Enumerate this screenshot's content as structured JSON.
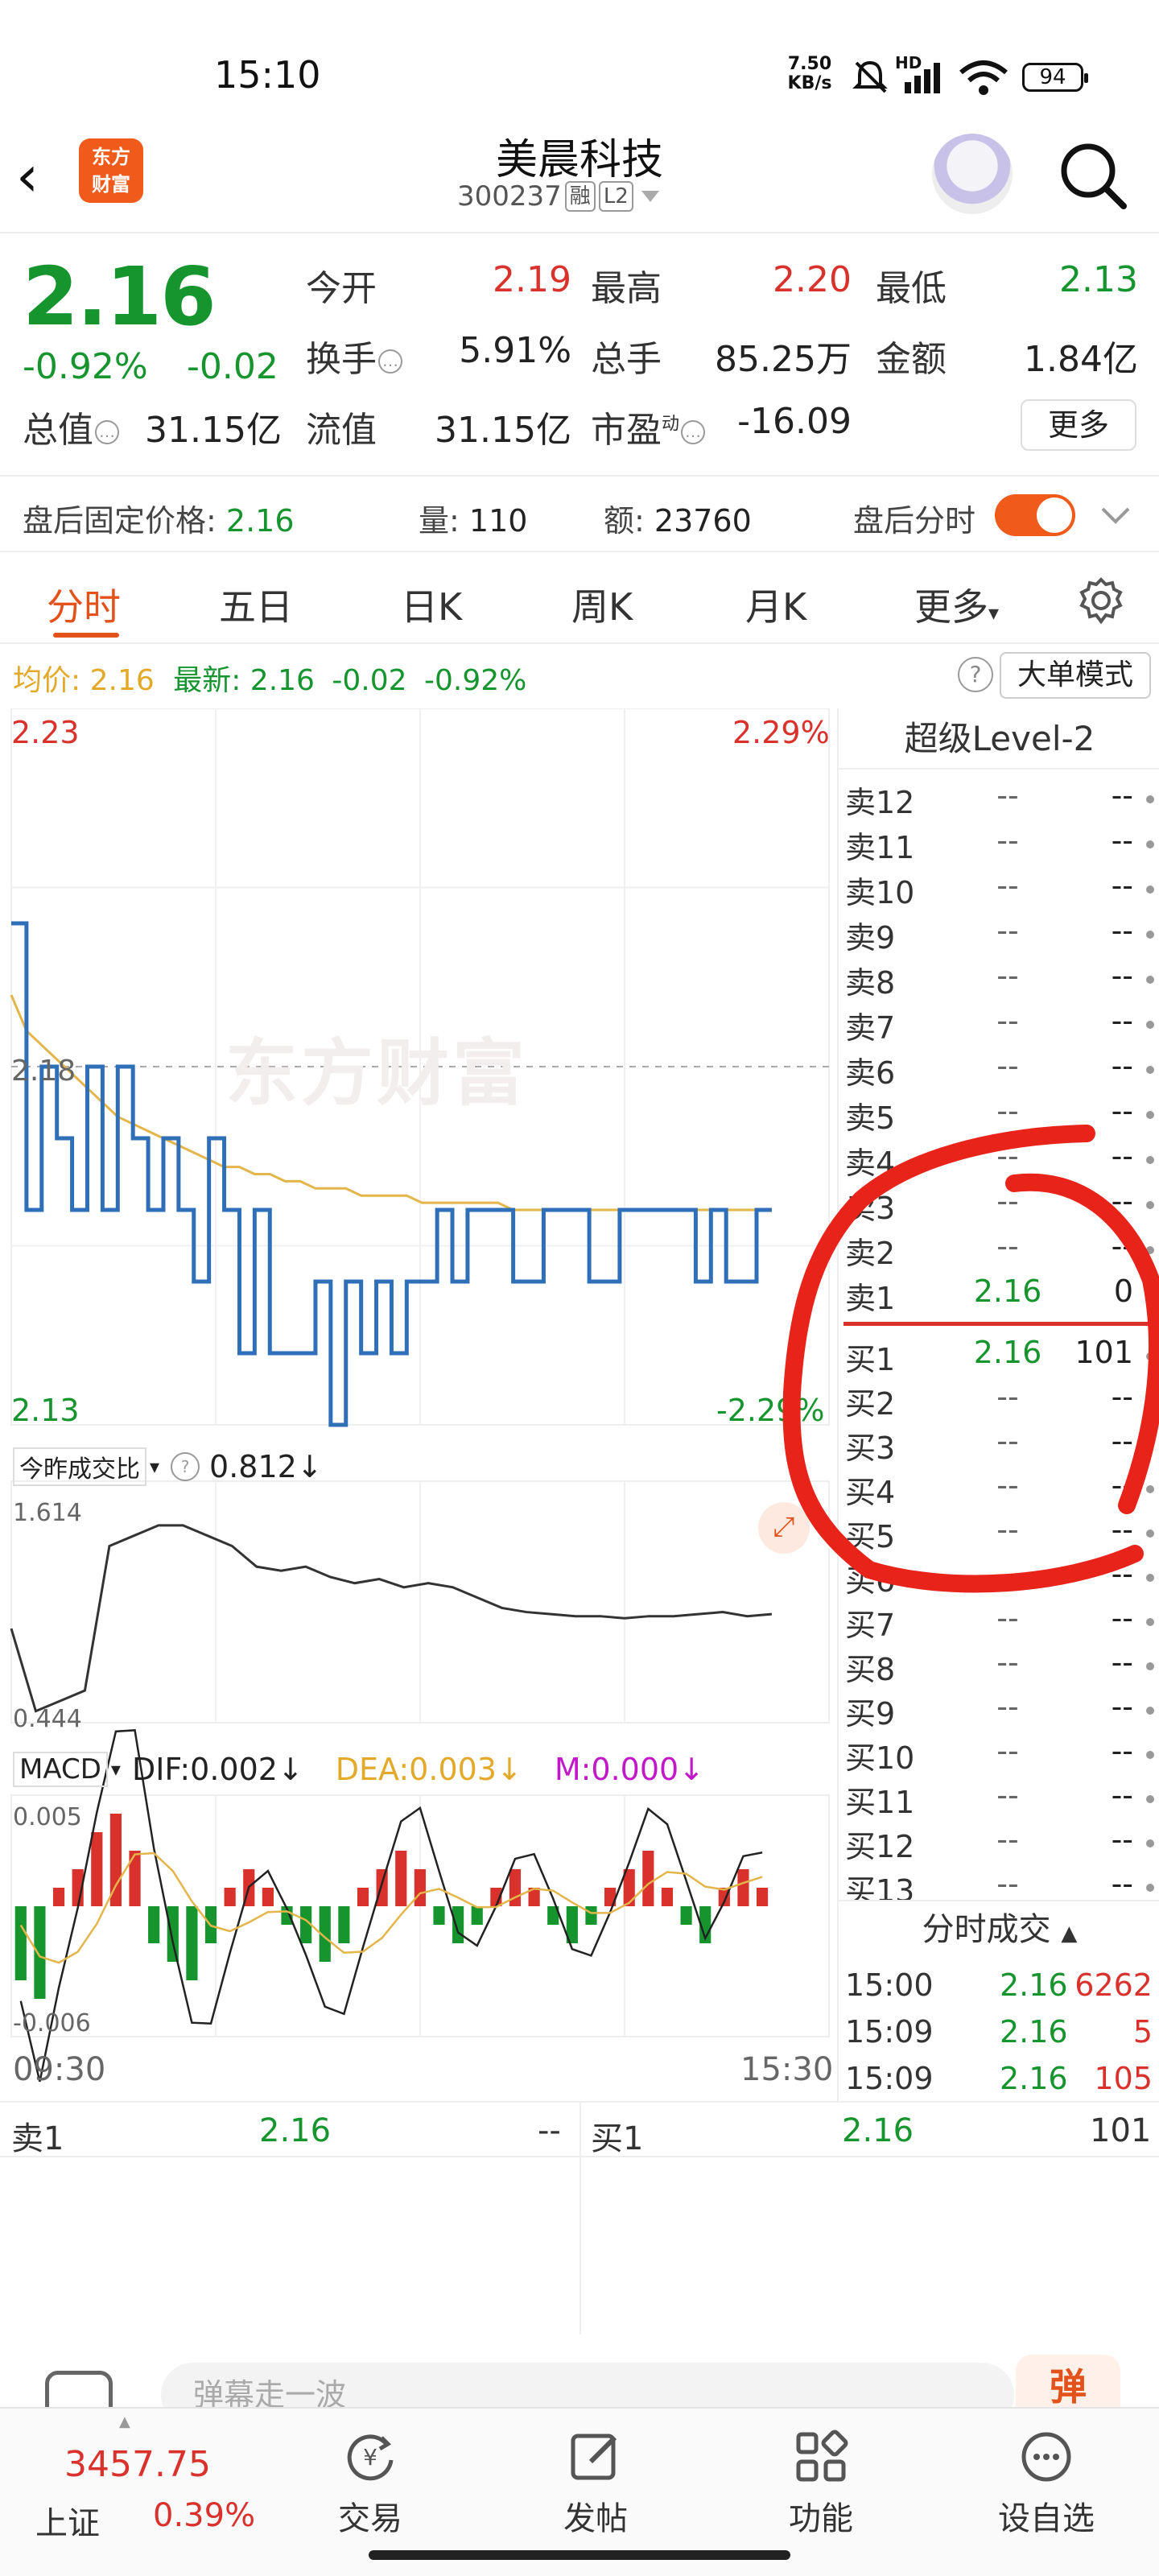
{
  "status_bar": {
    "time": "15:10",
    "net_speed": "7.50",
    "net_unit": "KB/s",
    "signal_tag": "HD",
    "battery": "94"
  },
  "header": {
    "stock_name": "美晨科技",
    "stock_code": "300237",
    "tag_margin": "融",
    "tag_level": "L2",
    "logo_line1": "东方",
    "logo_line2": "财富"
  },
  "quote": {
    "last_price": "2.16",
    "pct_change": "-0.92%",
    "abs_change": "-0.02",
    "open_label": "今开",
    "open": "2.19",
    "high_label": "最高",
    "high": "2.20",
    "low_label": "最低",
    "low": "2.13",
    "turnover_label": "换手",
    "turnover": "5.91%",
    "volume_label": "总手",
    "volume": "85.25万",
    "amount_label": "金额",
    "amount": "1.84亿",
    "mktcap_label": "总值",
    "mktcap": "31.15亿",
    "float_label": "流值",
    "float_cap": "31.15亿",
    "pe_label": "市盈",
    "pe_sup": "动",
    "pe": "-16.09",
    "more_label": "更多"
  },
  "afterhours": {
    "price_label": "盘后固定价格:",
    "price": "2.16",
    "vol_label": "量:",
    "vol": "110",
    "amt_label": "额:",
    "amt": "23760",
    "toggle_label": "盘后分时"
  },
  "tabs": [
    {
      "label": "分时"
    },
    {
      "label": "五日"
    },
    {
      "label": "日K"
    },
    {
      "label": "周K"
    },
    {
      "label": "月K"
    },
    {
      "label": "更多"
    }
  ],
  "chart_info": {
    "avg_label": "均价:",
    "avg": "2.16",
    "latest_label": "最新:",
    "latest": "2.16",
    "latest_chg": "-0.02",
    "latest_pct": "-0.92%",
    "big_order_mode": "大单模式"
  },
  "chart_data": [
    {
      "type": "line",
      "title": "",
      "ylim": [
        2.13,
        2.23
      ],
      "y_ticks": [
        "2.23",
        "2.18",
        "2.13"
      ],
      "y_pct_ticks": [
        "2.29%",
        "-2.29%"
      ],
      "x_ticks": [
        "09:30",
        "15:30"
      ],
      "watermark": "东方财富",
      "series": [
        {
          "values": [
            2.2,
            2.16,
            2.18,
            2.17,
            2.16,
            2.18,
            2.16,
            2.18,
            2.17,
            2.16,
            2.17,
            2.16,
            2.15,
            2.17,
            2.16,
            2.14,
            2.16,
            2.14,
            2.14,
            2.14,
            2.15,
            2.13,
            2.15,
            2.14,
            2.15,
            2.14,
            2.15,
            2.15,
            2.16,
            2.15,
            2.16,
            2.16,
            2.16,
            2.15,
            2.15,
            2.16,
            2.16,
            2.16,
            2.15,
            2.15,
            2.16,
            2.16,
            2.16,
            2.16,
            2.16,
            2.15,
            2.16,
            2.15,
            2.15,
            2.16,
            2.16
          ]
        },
        {
          "values": [
            2.19,
            2.185,
            2.183,
            2.181,
            2.179,
            2.177,
            2.175,
            2.173,
            2.172,
            2.171,
            2.17,
            2.169,
            2.168,
            2.167,
            2.166,
            2.166,
            2.165,
            2.165,
            2.164,
            2.164,
            2.163,
            2.163,
            2.163,
            2.162,
            2.162,
            2.162,
            2.162,
            2.161,
            2.161,
            2.161,
            2.161,
            2.161,
            2.161,
            2.16,
            2.16,
            2.16,
            2.16,
            2.16,
            2.16,
            2.16,
            2.16,
            2.16,
            2.16,
            2.16,
            2.16,
            2.16,
            2.16,
            2.16,
            2.16,
            2.16,
            2.16
          ]
        }
      ]
    },
    {
      "type": "line",
      "title": "今昨成交比",
      "value_label": "0.812",
      "ylim": [
        0.444,
        1.614
      ],
      "y_ticks": [
        "1.614",
        "0.444"
      ],
      "series": [
        {
          "values": [
            0.9,
            0.5,
            0.55,
            0.6,
            1.3,
            1.35,
            1.4,
            1.4,
            1.35,
            1.3,
            1.2,
            1.18,
            1.2,
            1.15,
            1.12,
            1.14,
            1.1,
            1.12,
            1.1,
            1.05,
            1.0,
            0.98,
            0.97,
            0.96,
            0.96,
            0.95,
            0.96,
            0.96,
            0.97,
            0.98,
            0.96,
            0.97
          ]
        }
      ]
    },
    {
      "type": "bar",
      "title": "MACD",
      "dif": "DIF:0.002",
      "dea": "DEA:0.003",
      "m": "M:0.000",
      "y_ticks": [
        "0.005",
        "-0.006"
      ],
      "values": [
        -0.004,
        -0.005,
        0.001,
        0.002,
        0.004,
        0.005,
        0.003,
        -0.002,
        -0.003,
        -0.004,
        -0.002,
        0.001,
        0.002,
        0.001,
        -0.001,
        -0.002,
        -0.003,
        -0.002,
        0.001,
        0.002,
        0.003,
        0.002,
        -0.001,
        -0.002,
        -0.001,
        0.001,
        0.002,
        0.001,
        -0.001,
        -0.002,
        -0.001,
        0.001,
        0.002,
        0.003,
        0.001,
        -0.001,
        -0.002,
        0.001,
        0.002,
        0.001
      ]
    }
  ],
  "order_book": {
    "title": "超级Level-2",
    "asks": [
      {
        "label": "卖12",
        "price": "--",
        "vol": "--"
      },
      {
        "label": "卖11",
        "price": "--",
        "vol": "--"
      },
      {
        "label": "卖10",
        "price": "--",
        "vol": "--"
      },
      {
        "label": "卖9",
        "price": "--",
        "vol": "--"
      },
      {
        "label": "卖8",
        "price": "--",
        "vol": "--"
      },
      {
        "label": "卖7",
        "price": "--",
        "vol": "--"
      },
      {
        "label": "卖6",
        "price": "--",
        "vol": "--"
      },
      {
        "label": "卖5",
        "price": "--",
        "vol": "--"
      },
      {
        "label": "卖4",
        "price": "--",
        "vol": "--"
      },
      {
        "label": "卖3",
        "price": "--",
        "vol": "--"
      },
      {
        "label": "卖2",
        "price": "--",
        "vol": "--"
      },
      {
        "label": "卖1",
        "price": "2.16",
        "vol": "0"
      }
    ],
    "bids": [
      {
        "label": "买1",
        "price": "2.16",
        "vol": "101"
      },
      {
        "label": "买2",
        "price": "--",
        "vol": "--"
      },
      {
        "label": "买3",
        "price": "--",
        "vol": "--"
      },
      {
        "label": "买4",
        "price": "--",
        "vol": "--"
      },
      {
        "label": "买5",
        "price": "--",
        "vol": "--"
      },
      {
        "label": "买6",
        "price": "--",
        "vol": "--"
      },
      {
        "label": "买7",
        "price": "--",
        "vol": "--"
      },
      {
        "label": "买8",
        "price": "--",
        "vol": "--"
      },
      {
        "label": "买9",
        "price": "--",
        "vol": "--"
      },
      {
        "label": "买10",
        "price": "--",
        "vol": "--"
      },
      {
        "label": "买11",
        "price": "--",
        "vol": "--"
      },
      {
        "label": "买12",
        "price": "--",
        "vol": "--"
      },
      {
        "label": "买13",
        "price": "--",
        "vol": "--"
      }
    ]
  },
  "trades": {
    "title": "分时成交",
    "rows": [
      {
        "time": "15:00",
        "price": "2.16",
        "vol": "6262"
      },
      {
        "time": "15:09",
        "price": "2.16",
        "vol": "5"
      },
      {
        "time": "15:09",
        "price": "2.16",
        "vol": "105"
      }
    ]
  },
  "summary": {
    "ask_label": "卖1",
    "ask_price": "2.16",
    "ask_vol": "--",
    "bid_label": "买1",
    "bid_price": "2.16",
    "bid_vol": "101"
  },
  "danmaku": {
    "placeholder": "弹幕走一波",
    "button": "弹"
  },
  "bottom_nav": {
    "index_value": "3457.75",
    "index_name": "上证",
    "index_pct": "0.39%",
    "items": [
      {
        "label": "交易"
      },
      {
        "label": "发帖"
      },
      {
        "label": "功能"
      },
      {
        "label": "设自选"
      }
    ]
  },
  "colors": {
    "up": "#d9312b",
    "down": "#16952f",
    "accent": "#e4521b",
    "avg_line": "#e3b54a",
    "price_line": "#2e6fb8",
    "annotation": "#e8231a"
  }
}
